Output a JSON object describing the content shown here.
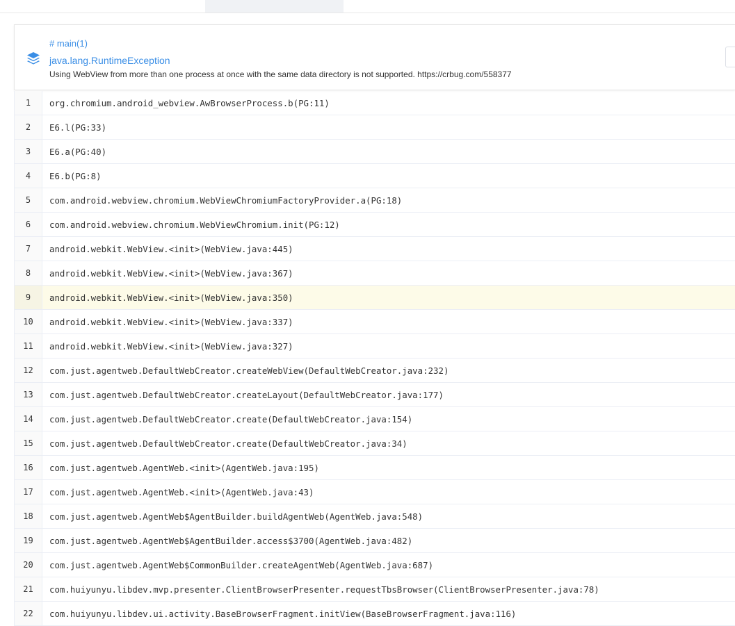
{
  "crash": {
    "thread": "# main(1)",
    "exception_type": "java.lang.RuntimeException",
    "message": "Using WebView from more than one process at once with the same data directory is not supported. https://crbug.com/558377",
    "icon": "layers-icon",
    "accent_color": "#3a8ee6"
  },
  "stack": {
    "highlight_color": "#fdfbe8",
    "frames": [
      {
        "no": "1",
        "text": "org.chromium.android_webview.AwBrowserProcess.b(PG:11)"
      },
      {
        "no": "2",
        "text": "E6.l(PG:33)"
      },
      {
        "no": "3",
        "text": "E6.a(PG:40)"
      },
      {
        "no": "4",
        "text": "E6.b(PG:8)"
      },
      {
        "no": "5",
        "text": "com.android.webview.chromium.WebViewChromiumFactoryProvider.a(PG:18)"
      },
      {
        "no": "6",
        "text": "com.android.webview.chromium.WebViewChromium.init(PG:12)"
      },
      {
        "no": "7",
        "text": "android.webkit.WebView.<init>(WebView.java:445)"
      },
      {
        "no": "8",
        "text": "android.webkit.WebView.<init>(WebView.java:367)"
      },
      {
        "no": "9",
        "text": "android.webkit.WebView.<init>(WebView.java:350)",
        "highlighted": true
      },
      {
        "no": "10",
        "text": "android.webkit.WebView.<init>(WebView.java:337)"
      },
      {
        "no": "11",
        "text": "android.webkit.WebView.<init>(WebView.java:327)"
      },
      {
        "no": "12",
        "text": "com.just.agentweb.DefaultWebCreator.createWebView(DefaultWebCreator.java:232)"
      },
      {
        "no": "13",
        "text": "com.just.agentweb.DefaultWebCreator.createLayout(DefaultWebCreator.java:177)"
      },
      {
        "no": "14",
        "text": "com.just.agentweb.DefaultWebCreator.create(DefaultWebCreator.java:154)"
      },
      {
        "no": "15",
        "text": "com.just.agentweb.DefaultWebCreator.create(DefaultWebCreator.java:34)"
      },
      {
        "no": "16",
        "text": "com.just.agentweb.AgentWeb.<init>(AgentWeb.java:195)"
      },
      {
        "no": "17",
        "text": "com.just.agentweb.AgentWeb.<init>(AgentWeb.java:43)"
      },
      {
        "no": "18",
        "text": "com.just.agentweb.AgentWeb$AgentBuilder.buildAgentWeb(AgentWeb.java:548)"
      },
      {
        "no": "19",
        "text": "com.just.agentweb.AgentWeb$AgentBuilder.access$3700(AgentWeb.java:482)"
      },
      {
        "no": "20",
        "text": "com.just.agentweb.AgentWeb$CommonBuilder.createAgentWeb(AgentWeb.java:687)"
      },
      {
        "no": "21",
        "text": "com.huiyunyu.libdev.mvp.presenter.ClientBrowserPresenter.requestTbsBrowser(ClientBrowserPresenter.java:78)"
      },
      {
        "no": "22",
        "text": "com.huiyunyu.libdev.ui.activity.BaseBrowserFragment.initView(BaseBrowserFragment.java:116)"
      }
    ]
  }
}
